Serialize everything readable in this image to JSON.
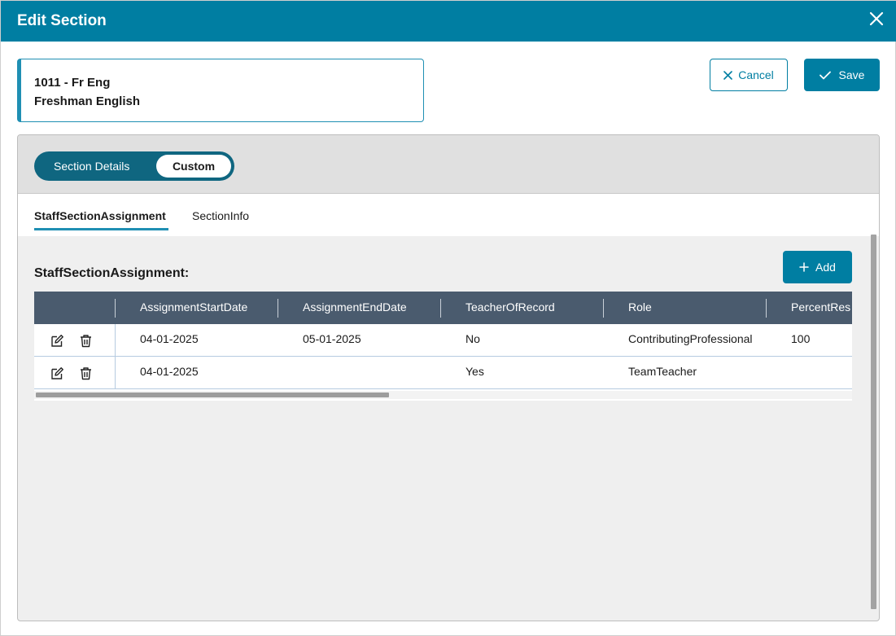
{
  "dialog": {
    "title": "Edit Section"
  },
  "info": {
    "line1": "1011 - Fr Eng",
    "line2": "Freshman English"
  },
  "actions": {
    "cancel_label": "Cancel",
    "save_label": "Save"
  },
  "toggle": {
    "option1": "Section Details",
    "option2": "Custom",
    "selected": "Custom"
  },
  "tabs": [
    {
      "label": "StaffSectionAssignment",
      "active": true
    },
    {
      "label": "SectionInfo",
      "active": false
    }
  ],
  "section": {
    "label": "StaffSectionAssignment:",
    "add_label": "Add"
  },
  "grid": {
    "columns": [
      "AssignmentStartDate",
      "AssignmentEndDate",
      "TeacherOfRecord",
      "Role",
      "PercentRes"
    ],
    "rows": [
      {
        "start": "04-01-2025",
        "end": "05-01-2025",
        "teacher": "No",
        "role": "ContributingProfessional",
        "percent": "100"
      },
      {
        "start": "04-01-2025",
        "end": "",
        "teacher": "Yes",
        "role": "TeamTeacher",
        "percent": ""
      }
    ]
  },
  "colors": {
    "primary": "#007ea2",
    "header": "#4a5b6e",
    "accent": "#1f8fb3"
  },
  "icons": [
    "close-icon",
    "x-icon",
    "check-icon",
    "plus-icon",
    "edit-icon",
    "trash-icon"
  ]
}
